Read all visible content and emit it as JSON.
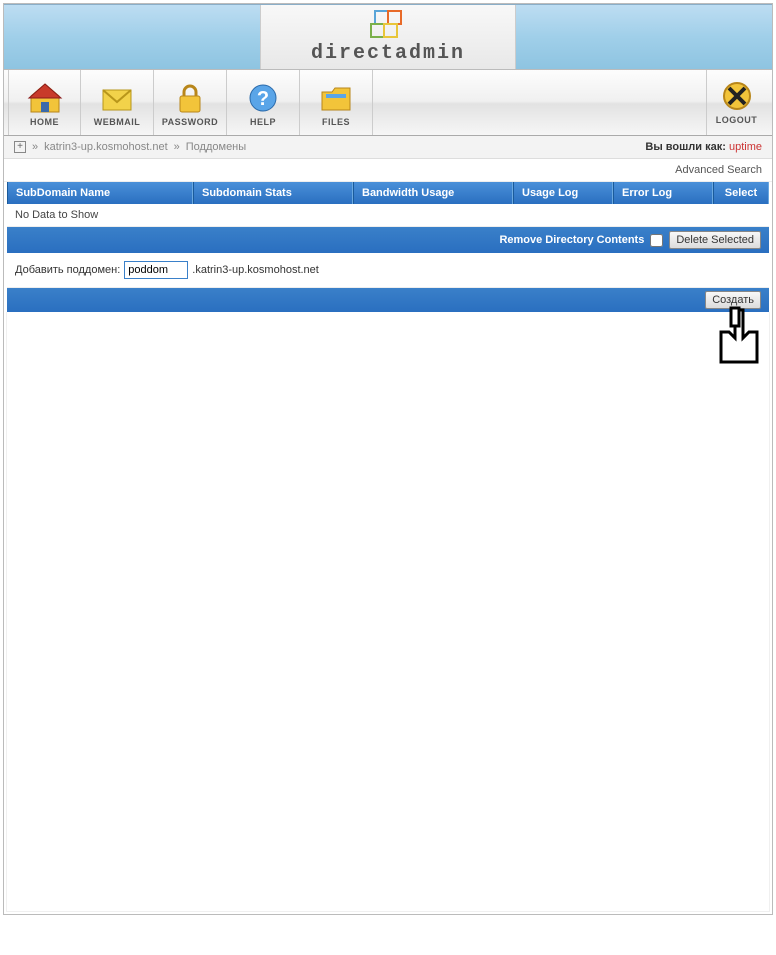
{
  "brand": "directadmin",
  "nav": {
    "home": "HOME",
    "webmail": "WEBMAIL",
    "password": "PASSWORD",
    "help": "HELP",
    "files": "FILES",
    "logout": "LOGOUT"
  },
  "breadcrumb": {
    "sep": "»",
    "domain": "katrin3-up.kosmohost.net",
    "page": "Поддомены",
    "logged_in_as": "Вы вошли как:",
    "user": "uptime"
  },
  "advanced_search": "Advanced Search",
  "table": {
    "headers": {
      "name": "SubDomain Name",
      "stats": "Subdomain Stats",
      "bandwidth": "Bandwidth Usage",
      "usage_log": "Usage Log",
      "error_log": "Error Log",
      "select": "Select"
    },
    "no_data": "No Data to Show"
  },
  "actions": {
    "remove_contents": "Remove Directory Contents",
    "delete_selected": "Delete Selected"
  },
  "add_form": {
    "label": "Добавить поддомен:",
    "value": "poddom",
    "suffix": ".katrin3-up.kosmohost.net",
    "create": "Создать"
  }
}
